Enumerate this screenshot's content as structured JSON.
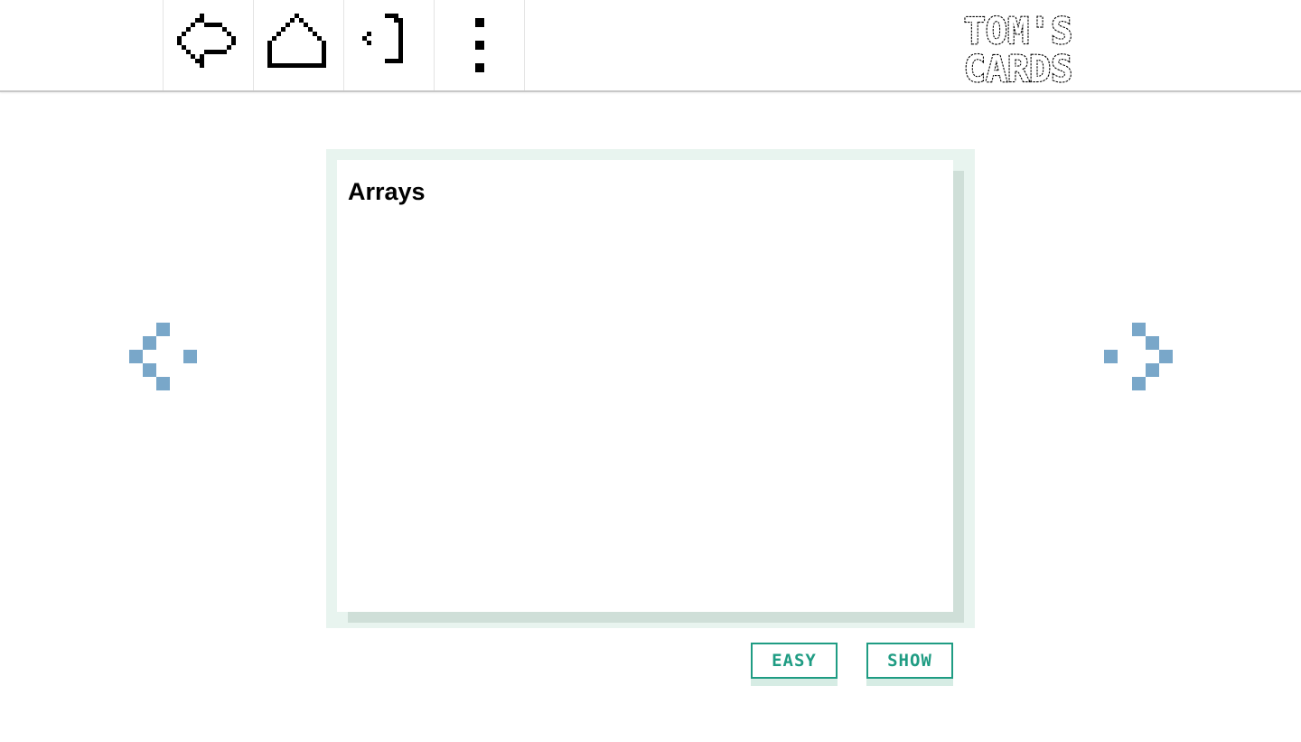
{
  "header": {
    "nav_icons": [
      "back-arrow-icon",
      "home-icon",
      "logout-icon",
      "more-vertical-icon"
    ],
    "logo": {
      "line1": "TOM'S",
      "line2": "CARDS"
    }
  },
  "card": {
    "title": "Arrays"
  },
  "navigation": {
    "prev_icon": "chevron-left-icon",
    "next_icon": "chevron-right-icon"
  },
  "actions": {
    "easy_label": "EASY",
    "show_label": "SHOW"
  },
  "colors": {
    "accent": "#1f9c83",
    "arrow": "#79a7c9",
    "card_frame": "#e8f4ef",
    "card_shadow": "#cfdfd8"
  }
}
